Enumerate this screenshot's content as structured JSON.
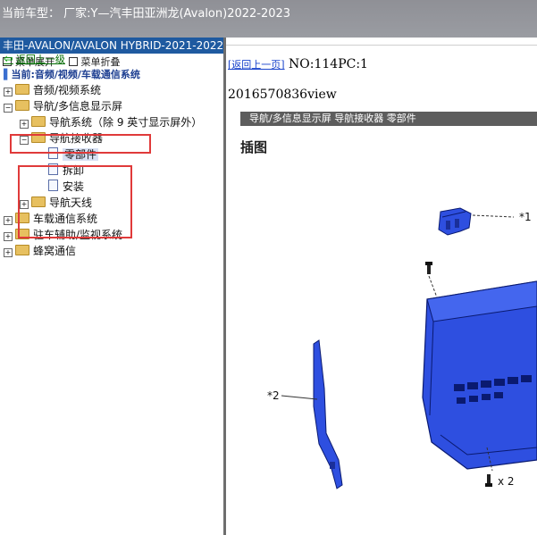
{
  "window": {
    "title": "当前车型：  厂家:Y—汽丰田亚洲龙(Avalon)2022-2023"
  },
  "sidebar": {
    "header": "丰田-AVALON/AVALON HYBRID-2021-2022-",
    "expand_all": "菜单展开",
    "collapse_all": "菜单折叠",
    "back_link": "返回上一级",
    "current_path": "当前:音频/视频/车载通信系统",
    "tree": [
      {
        "label": "音频/视频系统"
      },
      {
        "label": "导航/多信息显示屏"
      },
      {
        "label": "导航系统（除 9 英寸显示屏外）"
      },
      {
        "label": "导航接收器"
      },
      {
        "label": "零部件"
      },
      {
        "label": "拆卸"
      },
      {
        "label": "安装"
      },
      {
        "label": "导航天线"
      },
      {
        "label": "车载通信系统"
      },
      {
        "label": "驻车辅助/监视系统"
      },
      {
        "label": "蜂窝通信"
      }
    ]
  },
  "content": {
    "back_link": "[返回上一页]",
    "doc_no": "NO:114PC:1",
    "doc_id": "2016570836view",
    "breadcrumb": "导航/多信息显示屏  导航接收器  零部件",
    "section_title": "插图",
    "callouts": {
      "c1": "*1",
      "c2": "*2",
      "qty": "x 2"
    }
  },
  "colors": {
    "accent_blue": "#1f5aa0",
    "highlight_red": "#e03a3a",
    "part_blue": "#2e4fe0"
  }
}
